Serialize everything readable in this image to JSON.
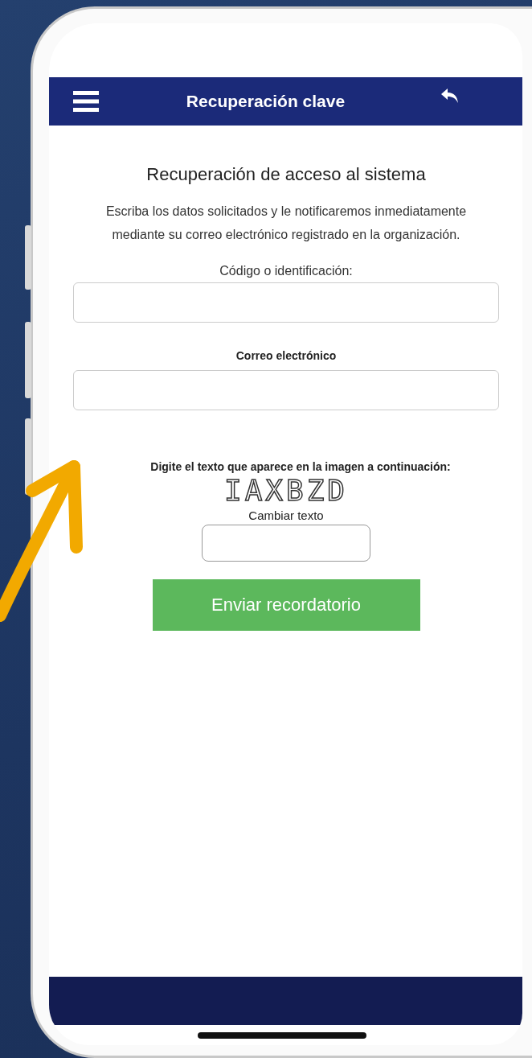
{
  "header": {
    "title": "Recuperación clave"
  },
  "heading": "Recuperación de acceso al sistema",
  "description": "Escriba los datos solicitados y le notificaremos inmediatamente mediante su correo electrónico registrado en la organización.",
  "fields": [
    {
      "label": "Código o identificación:",
      "kind": "plain"
    },
    {
      "label": "Correo electrónico",
      "kind": "bold"
    }
  ],
  "captcha": {
    "instruction": "Digite el texto que aparece en la imagen a continuación:",
    "text": "IAXBZD",
    "change_link": "Cambiar texto"
  },
  "submit_button": "Enviar recordatorio"
}
